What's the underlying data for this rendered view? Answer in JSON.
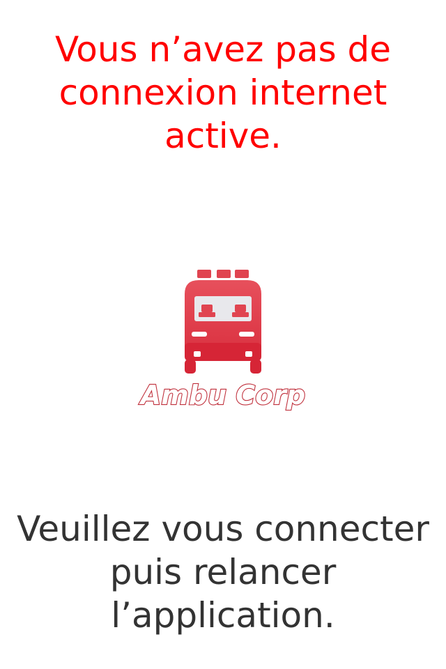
{
  "error": {
    "lines": [
      "Vous n’avez pas de",
      "connexion internet",
      "active."
    ]
  },
  "logo": {
    "brand_name": "Ambu Corp",
    "icon": "ambulance-icon",
    "color": "#e0404d"
  },
  "instructions": {
    "lines": [
      "Veuillez vous connecter",
      "puis relancer",
      "l’application."
    ]
  },
  "colors": {
    "error_text": "#ff0000",
    "body_text": "#333333",
    "background": "#ffffff"
  }
}
